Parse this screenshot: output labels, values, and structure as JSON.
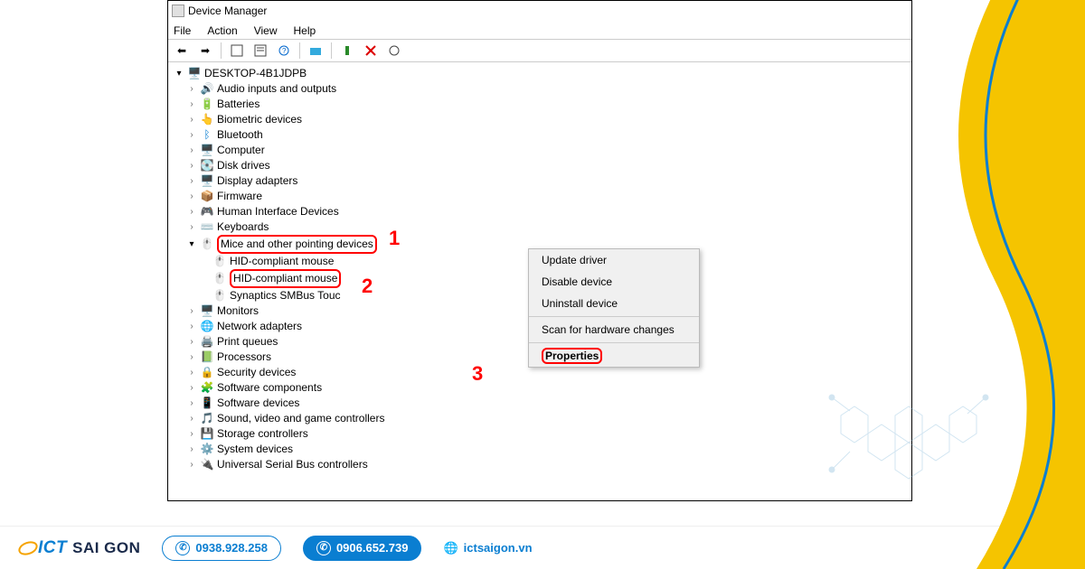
{
  "window": {
    "title": "Device Manager"
  },
  "menu": {
    "file": "File",
    "action": "Action",
    "view": "View",
    "help": "Help"
  },
  "tree": {
    "root": "DESKTOP-4B1JDPB",
    "items": [
      "Audio inputs and outputs",
      "Batteries",
      "Biometric devices",
      "Bluetooth",
      "Computer",
      "Disk drives",
      "Display adapters",
      "Firmware",
      "Human Interface Devices",
      "Keyboards",
      "Mice and other pointing devices"
    ],
    "mice_children": [
      "HID-compliant mouse",
      "HID-compliant mouse",
      "Synaptics SMBus Touc"
    ],
    "rest": [
      "Monitors",
      "Network adapters",
      "Print queues",
      "Processors",
      "Security devices",
      "Software components",
      "Software devices",
      "Sound, video and game controllers",
      "Storage controllers",
      "System devices",
      "Universal Serial Bus controllers"
    ]
  },
  "context": {
    "update": "Update driver",
    "disable": "Disable device",
    "uninstall": "Uninstall device",
    "scan": "Scan for hardware changes",
    "properties": "Properties"
  },
  "annotations": {
    "n1": "1",
    "n2": "2",
    "n3": "3"
  },
  "footer": {
    "brand_ict": "ICT",
    "brand_rest": "SAI GON",
    "phone1": "0938.928.258",
    "phone2": "0906.652.739",
    "site": "ictsaigon.vn"
  }
}
